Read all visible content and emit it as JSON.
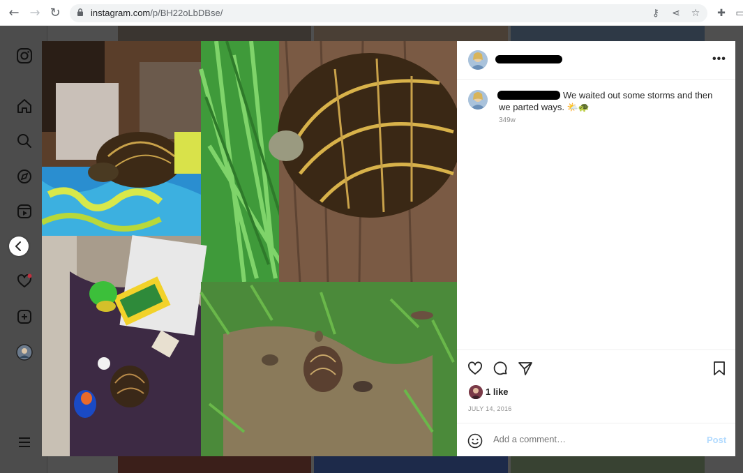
{
  "browser": {
    "url_host": "instagram.com",
    "url_path": "/p/BH22oLbDBse/"
  },
  "post": {
    "caption_text": "We waited out some storms and then we parted ways. 🌤️🐢",
    "caption_time": "349w",
    "likes": "1 like",
    "date": "JULY 14, 2016",
    "more": "•••"
  },
  "comment": {
    "placeholder": "Add a comment…",
    "post_label": "Post"
  },
  "sidebar": {
    "items": [
      "instagram-logo",
      "home",
      "search",
      "explore",
      "reels",
      "messages",
      "notifications",
      "create",
      "profile",
      "more"
    ]
  },
  "colors": {
    "accent": "#0095f6",
    "post_disabled": "#b3dbff",
    "notification_dot": "#ed4956"
  }
}
